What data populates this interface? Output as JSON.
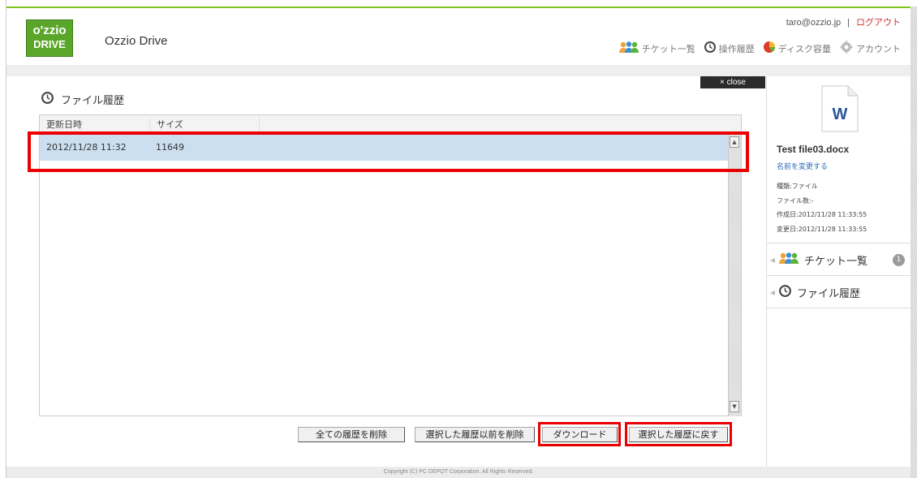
{
  "header": {
    "logo_line1": "o'zzio",
    "logo_line2": "DRIVE",
    "app_title": "Ozzio Drive",
    "user_email": "taro@ozzio.jp",
    "separator": "|",
    "logout": "ログアウト",
    "nav": [
      {
        "label": "チケット一覧",
        "icon": "users-icon"
      },
      {
        "label": "操作履歴",
        "icon": "clock-icon"
      },
      {
        "label": "ディスク容量",
        "icon": "pie-chart-icon"
      },
      {
        "label": "アカウント",
        "icon": "gear-icon"
      }
    ]
  },
  "panel": {
    "close_label": "× close",
    "title": "ファイル履歴",
    "columns": [
      "更新日時",
      "サイズ"
    ],
    "rows": [
      {
        "date": "2012/11/28 11:32",
        "size": "11649"
      }
    ],
    "buttons": {
      "delete_all": "全ての履歴を削除",
      "delete_before": "選択した履歴以前を削除",
      "download": "ダウンロード",
      "restore": "選択した履歴に戻す"
    }
  },
  "sidebar": {
    "file_name": "Test file03.docx",
    "rename": "名前を変更する",
    "meta": {
      "type": "種類:ファイル",
      "count": "ファイル数:-",
      "created": "作成日:2012/11/28 11:33:55",
      "modified": "変更日:2012/11/28 11:33:55"
    },
    "menu": [
      {
        "label": "チケット一覧",
        "badge": "1"
      },
      {
        "label": "ファイル履歴"
      }
    ]
  },
  "footer": {
    "copyright": "Copyright (C) PC DEPOT Corporation. All Rights Reserved."
  },
  "colors": {
    "brand_green": "#5aa62a",
    "selection": "#ccdff0",
    "highlight": "#ea0000",
    "link": "#2a6bb5"
  }
}
